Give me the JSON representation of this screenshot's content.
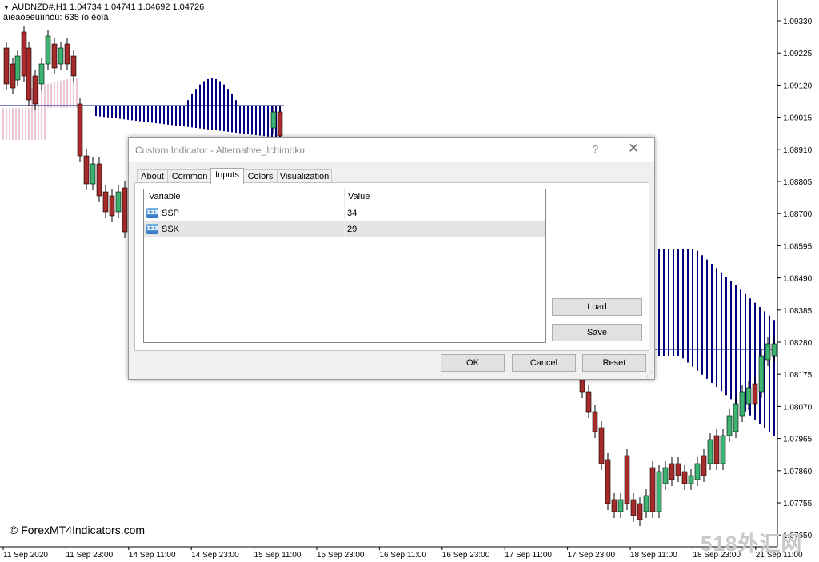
{
  "chart": {
    "symbol_line": "AUDNZD#,H1  1.04734 1.04741 1.04692 1.04726",
    "indicator_line": "âîëàòèëüíîñòü:  635 ïóíêòîâ",
    "watermark": "© ForexMT4Indicators.com",
    "corner_logo": "518外汇网",
    "price_labels": [
      "1.09330",
      "1.09225",
      "1.09120",
      "1.09015",
      "1.08910",
      "1.08805",
      "1.08700",
      "1.08595",
      "1.08490",
      "1.08385",
      "1.08280",
      "1.08175",
      "1.08070",
      "1.07965",
      "1.07860",
      "1.07755",
      "1.07650"
    ],
    "time_labels": [
      "11 Sep 2020",
      "11 Sep 23:00",
      "14 Sep 11:00",
      "14 Sep 23:00",
      "15 Sep 11:00",
      "15 Sep 23:00",
      "16 Sep 11:00",
      "16 Sep 23:00",
      "17 Sep 11:00",
      "17 Sep 23:00",
      "18 Sep 11:00",
      "18 Sep 23:00",
      "21 Sep 11:00"
    ],
    "colors": {
      "bull": "#3cb371",
      "bear": "#a52a2a",
      "cloud_up": "#000080",
      "cloud_down": "#e8b4c8",
      "baseline": "#000080"
    }
  },
  "dialog": {
    "title": "Custom Indicator - Alternative_Ichimoku",
    "help_label": "?",
    "close_label": "✕",
    "tabs": [
      "About",
      "Common",
      "Inputs",
      "Colors",
      "Visualization"
    ],
    "active_tab": "Inputs",
    "grid": {
      "columns": [
        "Variable",
        "Value"
      ],
      "rows": [
        {
          "icon": "123",
          "name": "SSP",
          "value": "34"
        },
        {
          "icon": "123",
          "name": "SSK",
          "value": "29"
        }
      ]
    },
    "buttons": {
      "load": "Load",
      "save": "Save",
      "ok": "OK",
      "cancel": "Cancel",
      "reset": "Reset"
    }
  }
}
